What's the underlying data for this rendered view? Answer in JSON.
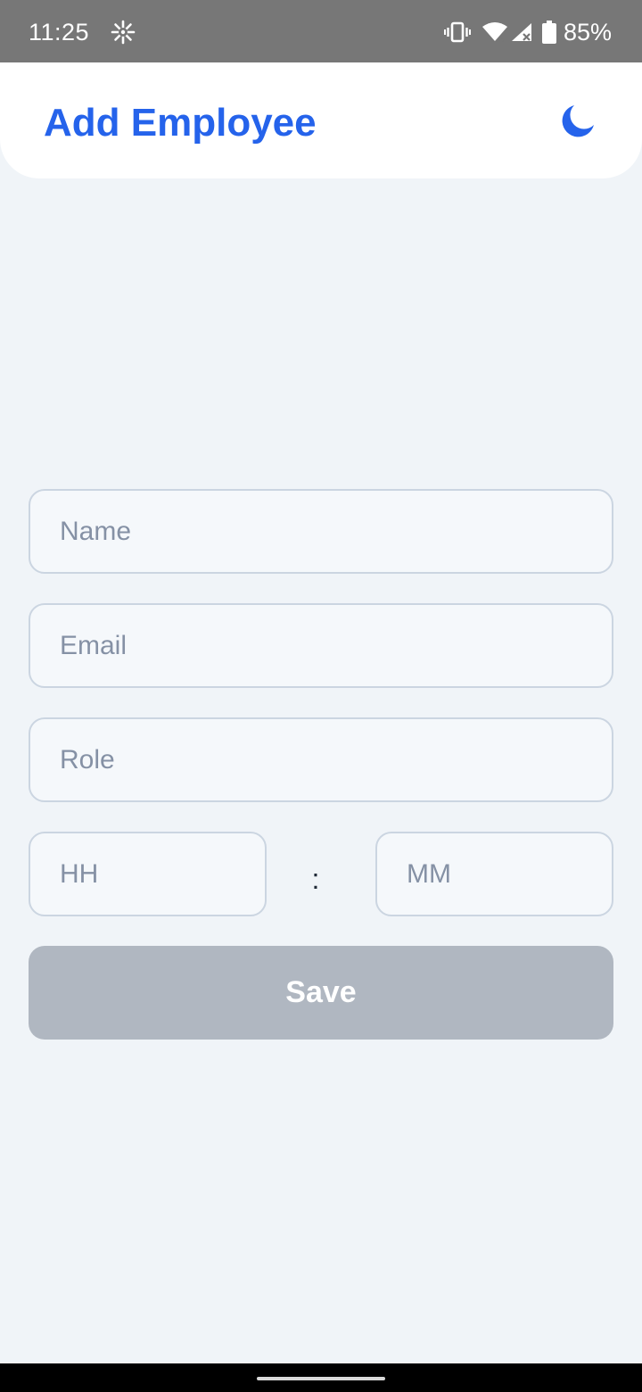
{
  "status_bar": {
    "time": "11:25",
    "battery": "85%",
    "icons": [
      "sync-icon",
      "vibrate-icon",
      "wifi-icon",
      "signal-icon",
      "battery-icon"
    ]
  },
  "header": {
    "title": "Add Employee",
    "theme_icon": "moon-icon",
    "accent_color": "#2563eb"
  },
  "form": {
    "name_placeholder": "Name",
    "email_placeholder": "Email",
    "role_placeholder": "Role",
    "hours_placeholder": "HH",
    "minutes_placeholder": "MM",
    "time_separator": ":",
    "save_label": "Save",
    "save_disabled_color": "#b0b7c1"
  }
}
